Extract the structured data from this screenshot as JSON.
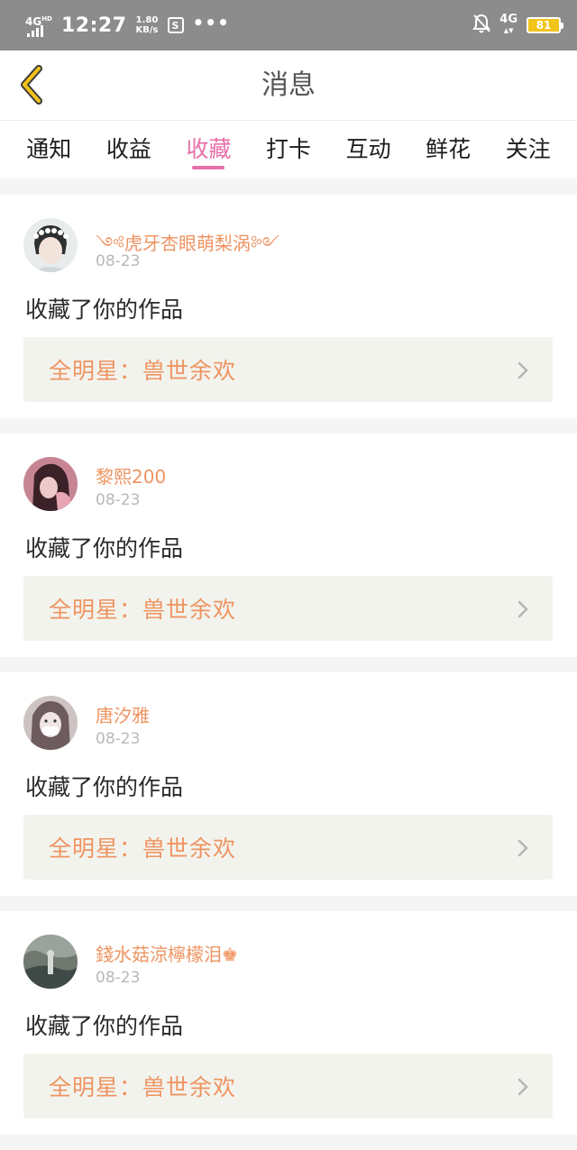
{
  "status_bar": {
    "network": "4G",
    "network_sup": "HD",
    "time": "12:27",
    "speed_value": "1.80",
    "speed_unit": "KB/s",
    "s_icon": "S",
    "more_dots": "•••",
    "cell_right": "4G",
    "battery": "81",
    "icons": [
      "signal-icon",
      "app-s-icon",
      "bell-off-icon",
      "battery-icon"
    ]
  },
  "header": {
    "title": "消息",
    "back_icon": "back-chevron-icon"
  },
  "tabs": [
    {
      "label": "通知",
      "active": false
    },
    {
      "label": "收益",
      "active": false
    },
    {
      "label": "收藏",
      "active": true
    },
    {
      "label": "打卡",
      "active": false
    },
    {
      "label": "互动",
      "active": false
    },
    {
      "label": "鲜花",
      "active": false
    },
    {
      "label": "关注",
      "active": false
    }
  ],
  "colors": {
    "accent_pink": "#e76fa8",
    "username_orange": "#ee9462",
    "link_bg": "#f3f3ed"
  },
  "messages": [
    {
      "user": "༺虎牙杏眼萌梨涡༻",
      "date": "08-23",
      "action": "收藏了你的作品",
      "work": "全明星：兽世余欢"
    },
    {
      "user": "黎熙200",
      "date": "08-23",
      "action": "收藏了你的作品",
      "work": "全明星：兽世余欢"
    },
    {
      "user": "唐汐雅",
      "date": "08-23",
      "action": "收藏了你的作品",
      "work": "全明星：兽世余欢"
    },
    {
      "user": "錢水菇涼檸檬泪♚",
      "date": "08-23",
      "action": "收藏了你的作品",
      "work": "全明星：兽世余欢"
    }
  ]
}
